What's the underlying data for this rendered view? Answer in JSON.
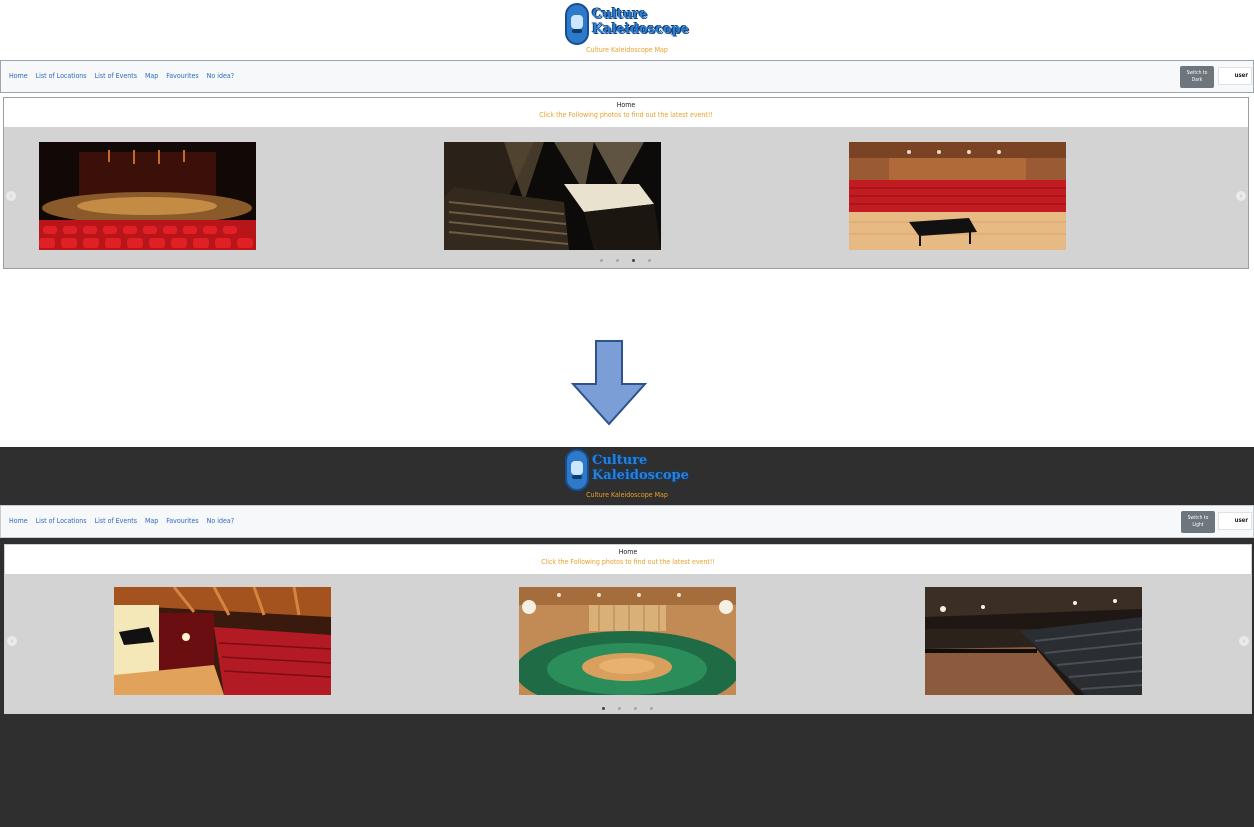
{
  "colors": {
    "accent_blue": "#2d68c4",
    "accent_orange": "#e8a22a",
    "dark_bg": "#2f2f2f",
    "arrow_fill": "#7b9ed6"
  },
  "light_view": {
    "logo": {
      "line1": "Culture",
      "line2": "Kaleidoscope"
    },
    "subtitle": "Culture Kaleidoscope Map",
    "nav": [
      "Home",
      "List of Locations",
      "List of Events",
      "Map",
      "Favourites",
      "No idea?"
    ],
    "switch_button": {
      "line1": "Switch to",
      "line2": "Dark"
    },
    "user": "user",
    "card": {
      "title": "Home",
      "hint": "Click the Following photos to find out the latest event!!"
    },
    "carousel": {
      "prev_icon": "‹",
      "next_icon": "›",
      "slides": [
        "concert-hall-red-seats",
        "black-box-theatre",
        "recital-hall-piano"
      ],
      "active_dot": 2,
      "dot_count": 4
    }
  },
  "dark_view": {
    "logo": {
      "line1": "Culture",
      "line2": "Kaleidoscope"
    },
    "subtitle": "Culture Kaleidoscope Map",
    "nav": [
      "Home",
      "List of Locations",
      "List of Events",
      "Map",
      "Favourites",
      "No idea?"
    ],
    "switch_button": {
      "line1": "Switch to",
      "line2": "Light"
    },
    "user": "user",
    "card": {
      "title": "Home",
      "hint": "Click the Following photos to find out the latest event!!"
    },
    "carousel": {
      "prev_icon": "‹",
      "next_icon": "›",
      "slides": [
        "theatre-stage-piano",
        "concert-hall-in-the-round",
        "studio-theatre"
      ],
      "active_dot": 0,
      "dot_count": 4
    }
  }
}
